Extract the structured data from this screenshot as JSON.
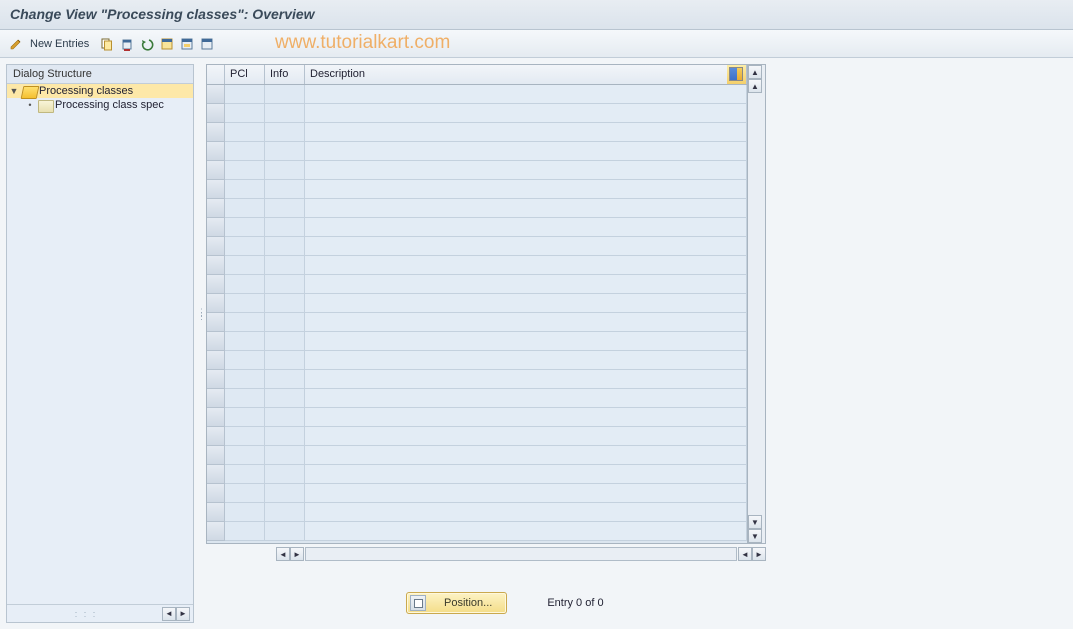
{
  "title": "Change View \"Processing classes\": Overview",
  "toolbar": {
    "new_entries": "New Entries"
  },
  "watermark": "www.tutorialkart.com",
  "tree": {
    "header": "Dialog Structure",
    "nodes": [
      {
        "label": "Processing classes",
        "selected": true,
        "open": true,
        "indent": 0
      },
      {
        "label": "Processing class spec",
        "selected": false,
        "open": false,
        "indent": 1
      }
    ]
  },
  "grid": {
    "columns": {
      "pcl": "PCl",
      "info": "Info",
      "desc": "Description"
    },
    "row_count": 24
  },
  "footer": {
    "position_label": "Position...",
    "entry_text": "Entry 0 of 0"
  }
}
